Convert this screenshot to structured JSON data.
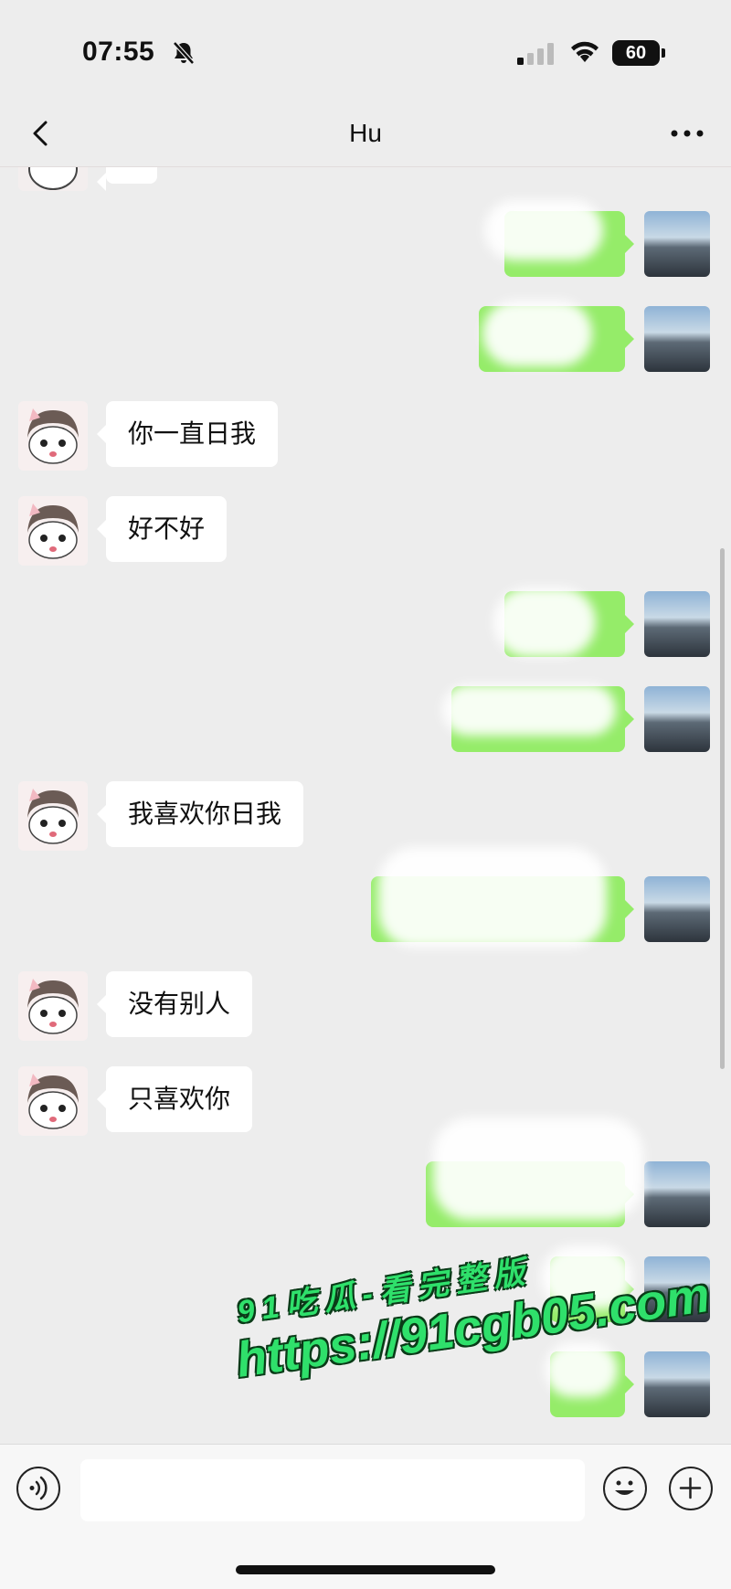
{
  "status_bar": {
    "time": "07:55",
    "battery": "60"
  },
  "nav": {
    "title": "Hu"
  },
  "messages": [
    {
      "side": "left",
      "text": "你一直日我"
    },
    {
      "side": "left",
      "text": "好不好"
    },
    {
      "side": "left",
      "text": "我喜欢你日我"
    },
    {
      "side": "left",
      "text": "没有别人"
    },
    {
      "side": "left",
      "text": "只喜欢你"
    }
  ],
  "watermark": {
    "line1": "91吃瓜-看完整版",
    "line2": "https://91cgb05.com"
  },
  "colors": {
    "background": "#ededed",
    "sent_bubble": "#95ec69",
    "received_bubble": "#ffffff",
    "watermark": "#2fe06b"
  }
}
